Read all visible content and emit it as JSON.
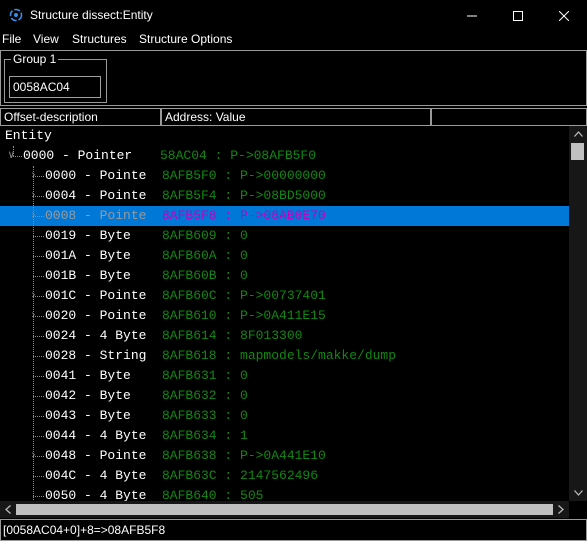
{
  "window": {
    "title": "Structure dissect:Entity",
    "icon": "cheat-engine-icon"
  },
  "menu": {
    "items": [
      "File",
      "View",
      "Structures",
      "Structure Options"
    ]
  },
  "group": {
    "label": "Group 1",
    "address": "0058AC04"
  },
  "columns": {
    "headers": [
      "Offset-description",
      "Address: Value",
      ""
    ]
  },
  "tree": {
    "root_label": "Entity",
    "rows": [
      {
        "label": "0000 - Pointer",
        "value": "58AC04 : P->08AFB5F0",
        "expander": "down",
        "level": 0,
        "selected": false
      },
      {
        "label": "0000 - Pointe",
        "value": "8AFB5F0 : P->00000000",
        "expander": "right",
        "level": 1,
        "selected": false
      },
      {
        "label": "0004 - Pointe",
        "value": "8AFB5F4 : P->08BD5000",
        "expander": "right",
        "level": 1,
        "selected": false
      },
      {
        "label": "0008 - Pointe",
        "value": "8AFB5F8 : P->08AB0E70",
        "expander": "right",
        "level": 1,
        "selected": true
      },
      {
        "label": "0019 - Byte",
        "value": "8AFB609 : 0",
        "expander": "",
        "level": 1,
        "selected": false
      },
      {
        "label": "001A - Byte",
        "value": "8AFB60A : 0",
        "expander": "",
        "level": 1,
        "selected": false
      },
      {
        "label": "001B - Byte",
        "value": "8AFB60B : 0",
        "expander": "",
        "level": 1,
        "selected": false
      },
      {
        "label": "001C - Pointe",
        "value": "8AFB60C : P->00737401",
        "expander": "right",
        "level": 1,
        "selected": false
      },
      {
        "label": "0020 - Pointe",
        "value": "8AFB610 : P->0A411E15",
        "expander": "right",
        "level": 1,
        "selected": false
      },
      {
        "label": "0024 - 4 Byte",
        "value": "8AFB614 : 8F013300",
        "expander": "",
        "level": 1,
        "selected": false
      },
      {
        "label": "0028 - String",
        "value": "8AFB618 : mapmodels/makke/dump",
        "expander": "",
        "level": 1,
        "selected": false
      },
      {
        "label": "0041 - Byte",
        "value": "8AFB631 : 0",
        "expander": "",
        "level": 1,
        "selected": false
      },
      {
        "label": "0042 - Byte",
        "value": "8AFB632 : 0",
        "expander": "",
        "level": 1,
        "selected": false
      },
      {
        "label": "0043 - Byte",
        "value": "8AFB633 : 0",
        "expander": "",
        "level": 1,
        "selected": false
      },
      {
        "label": "0044 - 4 Byte",
        "value": "8AFB634 : 1",
        "expander": "",
        "level": 1,
        "selected": false
      },
      {
        "label": "0048 - Pointe",
        "value": "8AFB638 : P->0A441E10",
        "expander": "right",
        "level": 1,
        "selected": false
      },
      {
        "label": "004C - 4 Byte",
        "value": "8AFB63C : 2147562496",
        "expander": "",
        "level": 1,
        "selected": false
      },
      {
        "label": "0050 - 4 Byte",
        "value": "8AFB640 : 505",
        "expander": "",
        "level": 1,
        "selected": false
      }
    ]
  },
  "status": {
    "text": "[0058AC04+0]+8=>08AFB5F8"
  },
  "colors": {
    "background": "#000000",
    "value_text": "#118811",
    "selected_row": "#0078d7",
    "selected_value": "#c000c0",
    "border": "#9a9a9a"
  }
}
